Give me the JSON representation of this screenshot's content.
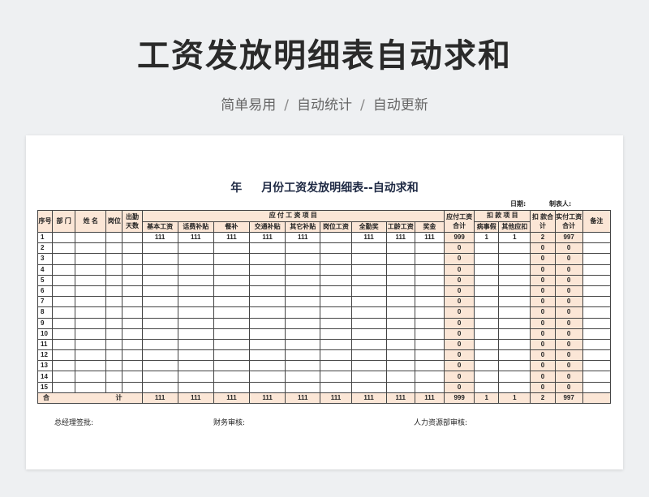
{
  "page": {
    "title": "工资发放明细表自动求和",
    "tags": [
      "简单易用",
      "自动统计",
      "自动更新"
    ],
    "separator": "/"
  },
  "sheet": {
    "title_year": "年",
    "title_rest": "月份工资发放明细表--自动求和",
    "date_label": "日期:",
    "maker_label": "制表人:",
    "headers": {
      "seq": "序号",
      "dept": "部  门",
      "name": "姓  名",
      "post": "岗位",
      "attend": "出勤天数",
      "payable_group": "应  付  工  资  项  目",
      "payable_total": "应付工资合计",
      "deduct_group": "扣  款  项  目",
      "deduct_total": "扣  款合  计",
      "net_total": "实付工资合计",
      "remark": "备注",
      "payable_items": [
        "基本工资",
        "话费补贴",
        "餐补",
        "交通补贴",
        "其它补贴",
        "岗位工资",
        "全勤奖",
        "工龄工资",
        "奖金"
      ],
      "deduct_items": [
        "病事假",
        "其他应扣"
      ]
    },
    "first_row": {
      "payable_items": [
        "111",
        "111",
        "111",
        "111",
        "111",
        "",
        "111",
        "111",
        "111"
      ],
      "payable_total": "999",
      "deduct_items": [
        "1",
        "1"
      ],
      "deduct_total": "2",
      "net_total": "997"
    },
    "row_numbers": [
      "1",
      "2",
      "3",
      "4",
      "5",
      "6",
      "7",
      "8",
      "9",
      "10",
      "11",
      "12",
      "13",
      "14",
      "15"
    ],
    "zero_value": "0",
    "total_row": {
      "label_left": "合",
      "label_right": "计",
      "payable_items": [
        "111",
        "111",
        "111",
        "111",
        "111",
        "111",
        "111",
        "111",
        "111"
      ],
      "payable_total": "999",
      "deduct_items": [
        "1",
        "1"
      ],
      "deduct_total": "2",
      "net_total": "997"
    },
    "signatures": [
      "总经理签批:",
      "财务审核:",
      "人力资源部审核:"
    ]
  }
}
